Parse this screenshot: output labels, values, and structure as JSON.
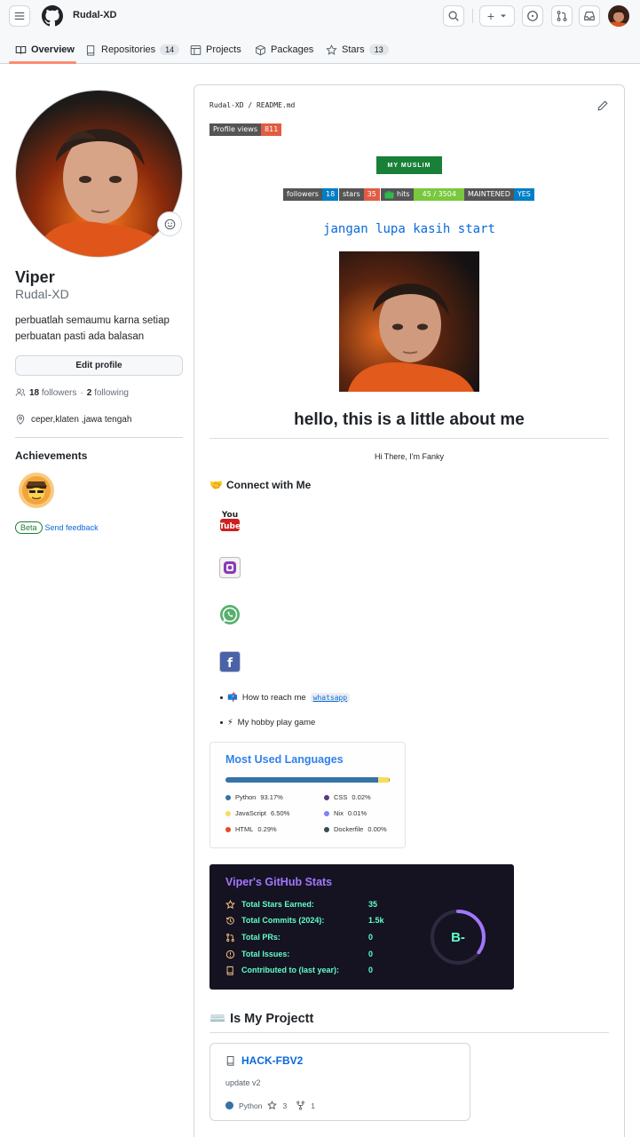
{
  "header": {
    "username": "Rudal-XD",
    "tabs": [
      {
        "label": "Overview",
        "count": null
      },
      {
        "label": "Repositories",
        "count": "14"
      },
      {
        "label": "Projects",
        "count": null
      },
      {
        "label": "Packages",
        "count": null
      },
      {
        "label": "Stars",
        "count": "13"
      }
    ],
    "plus_label": "+"
  },
  "profile": {
    "display_name": "Viper",
    "login": "Rudal-XD",
    "bio": "perbuatlah semaumu karna setiap perbuatan pasti ada balasan",
    "edit_label": "Edit profile",
    "followers_count": "18",
    "followers_label": "followers",
    "following_sep": "·",
    "following_count": "2",
    "following_label": "following",
    "location": "ceper,klaten ,jawa tengah",
    "achievements_title": "Achievements",
    "beta_label": "Beta",
    "feedback_label": "Send feedback"
  },
  "readme": {
    "path": "Rudal-XD / README.md",
    "profile_views_label": "Profile views",
    "profile_views_value": "811",
    "muslim_badge": "MY MUSLIM",
    "badges": [
      {
        "label": "followers",
        "value": "18",
        "color": "#007ec6"
      },
      {
        "label": "stars",
        "value": "35",
        "color": "#e05d44"
      },
      {
        "label": "hits",
        "value": "45 / 3504",
        "color": "#79c83d"
      },
      {
        "label": "MAINTENED",
        "value": "YES",
        "color": "#007ec6"
      }
    ],
    "star_text": "jangan lupa kasih start",
    "hello": "hello, this is a little about me",
    "hi_there": "Hi There, I'm Fanky",
    "connect_emoji": "🤝",
    "connect_title": "Connect with Me",
    "youtube_top": "You",
    "youtube_bottom": "Tube",
    "facebook_letter": "f",
    "bullets": [
      {
        "emoji": "📫",
        "text": "How to reach me",
        "code": "whatsapp"
      },
      {
        "emoji": "⚡",
        "text": "My hobby play game",
        "code": ""
      }
    ],
    "projects_emoji": "⌨️",
    "projects_title": "Is My Projectt"
  },
  "languages": {
    "title": "Most Used Languages",
    "items": [
      {
        "name": "Python",
        "percent": "93.17%",
        "value": 93.17,
        "color": "#3572A5"
      },
      {
        "name": "CSS",
        "percent": "0.02%",
        "value": 0.02,
        "color": "#563d7c"
      },
      {
        "name": "JavaScript",
        "percent": "6.50%",
        "value": 6.5,
        "color": "#f1e05a"
      },
      {
        "name": "Nix",
        "percent": "0.01%",
        "value": 0.01,
        "color": "#7e7eff"
      },
      {
        "name": "HTML",
        "percent": "0.29%",
        "value": 0.29,
        "color": "#e34c26"
      },
      {
        "name": "Dockerfile",
        "percent": "0.00%",
        "value": 0.001,
        "color": "#384d54"
      }
    ]
  },
  "stats": {
    "title": "Viper's GitHub Stats",
    "rows": [
      {
        "icon": "star-icon",
        "label": "Total Stars Earned:",
        "value": "35"
      },
      {
        "icon": "history-icon",
        "label": "Total Commits (2024):",
        "value": "1.5k"
      },
      {
        "icon": "pr-icon",
        "label": "Total PRs:",
        "value": "0"
      },
      {
        "icon": "issue-icon",
        "label": "Total Issues:",
        "value": "0"
      },
      {
        "icon": "repo-icon",
        "label": "Contributed to (last year):",
        "value": "0"
      }
    ],
    "rank": "B-",
    "rank_progress": 0.35,
    "title_color": "#a277ff",
    "text_color": "#61ffca",
    "ring_color": "#a277ff"
  },
  "repo": {
    "name": "HACK-FBV2",
    "description": "update v2",
    "language": "Python",
    "stars": "3",
    "forks": "1"
  }
}
